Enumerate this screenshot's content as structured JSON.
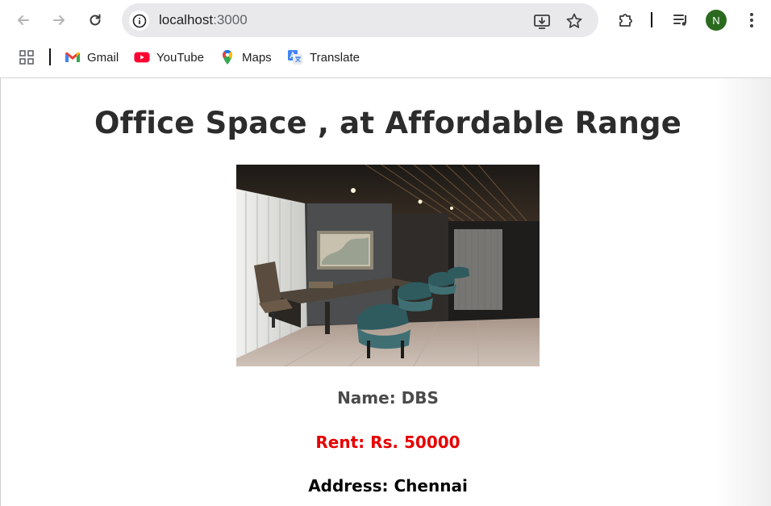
{
  "browser": {
    "url_host": "localhost",
    "url_port": ":3000",
    "profile_initial": "N",
    "colors": {
      "avatar": "#2b6a1e",
      "omnibox": "#e9e9eb"
    },
    "bookmarks": [
      {
        "label": "Gmail",
        "icon": "gmail-icon"
      },
      {
        "label": "YouTube",
        "icon": "youtube-icon"
      },
      {
        "label": "Maps",
        "icon": "maps-icon"
      },
      {
        "label": "Translate",
        "icon": "translate-icon"
      }
    ]
  },
  "page": {
    "heading": "Office Space , at Affordable Range",
    "name_text": "Name: DBS",
    "rent_text": "Rent: Rs. 50000",
    "address_text": "Address: Chennai",
    "colors": {
      "heading": "#2c2c2c",
      "name": "#4a4a4a",
      "rent": "#e60000",
      "address": "#000000"
    }
  }
}
